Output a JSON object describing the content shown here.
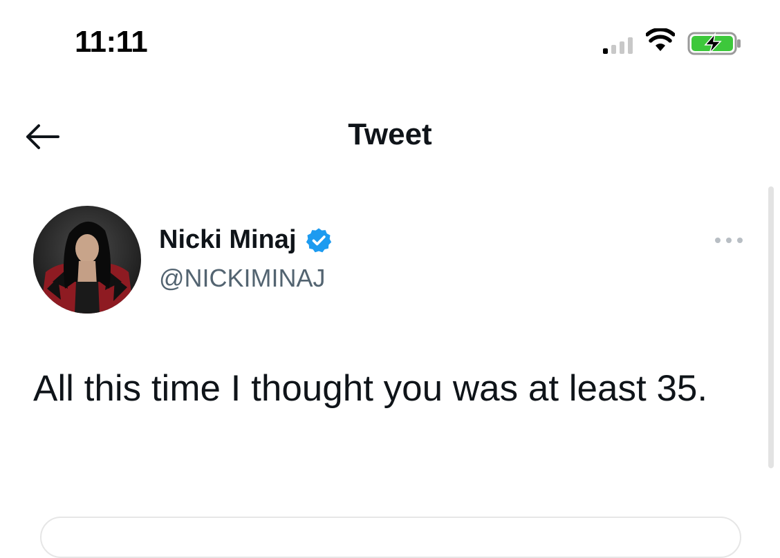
{
  "status_bar": {
    "time": "11:11",
    "signal_icon": "cellular-signal-icon",
    "wifi_icon": "wifi-icon",
    "battery_icon": "battery-charging-icon",
    "battery_color": "#3dc83b"
  },
  "nav": {
    "back_icon": "back-arrow-icon",
    "title": "Tweet"
  },
  "tweet": {
    "author": {
      "display_name": "Nicki Minaj",
      "handle": "@NICKIMINAJ",
      "verified": true,
      "verified_color": "#1d9bf0"
    },
    "more_icon": "more-options-icon",
    "text": "All this time I thought you was at least 35."
  },
  "colors": {
    "text_primary": "#0f1419",
    "text_secondary": "#536471",
    "accent": "#1d9bf0"
  }
}
